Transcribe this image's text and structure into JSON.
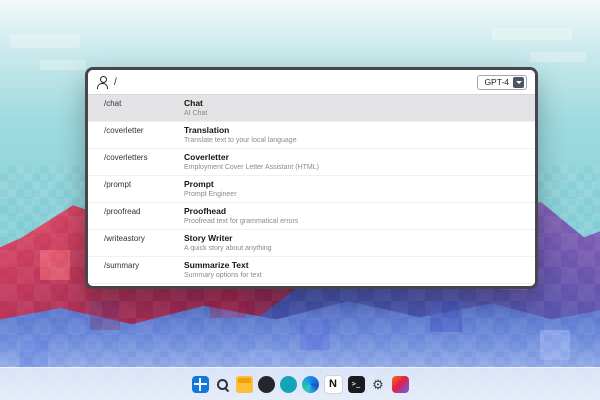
{
  "window": {
    "header": {
      "path": "/",
      "model": "GPT-4",
      "icons": {
        "left": "user-icon",
        "model_dropdown": "chevron-down-icon"
      }
    },
    "rows": [
      {
        "command": "/chat",
        "title": "Chat",
        "subtitle": "AI Chat",
        "selected": true
      },
      {
        "command": "/coverletter",
        "title": "Translation",
        "subtitle": "Translate text to your local language",
        "selected": false
      },
      {
        "command": "/coverletters",
        "title": "Coverletter",
        "subtitle": "Employment Cover Letter Assistant (HTML)",
        "selected": false
      },
      {
        "command": "/prompt",
        "title": "Prompt",
        "subtitle": "Prompt Engineer",
        "selected": false
      },
      {
        "command": "/proofread",
        "title": "Proofhead",
        "subtitle": "Proofread text for grammatical errors",
        "selected": false
      },
      {
        "command": "/writeastory",
        "title": "Story Writer",
        "subtitle": "A quick story about anything",
        "selected": false
      },
      {
        "command": "/summary",
        "title": "Summarize Text",
        "subtitle": "Summary options for text",
        "selected": false
      }
    ]
  },
  "taskbar": {
    "icons": [
      {
        "name": "start-icon",
        "glyph": ""
      },
      {
        "name": "search-icon",
        "glyph": ""
      },
      {
        "name": "file-explorer-icon",
        "glyph": ""
      },
      {
        "name": "github-icon",
        "glyph": ""
      },
      {
        "name": "chat-icon",
        "glyph": ""
      },
      {
        "name": "edge-icon",
        "glyph": ""
      },
      {
        "name": "notion-icon",
        "glyph": "N"
      },
      {
        "name": "terminal-icon",
        "glyph": ">_"
      },
      {
        "name": "settings-icon",
        "glyph": "⚙"
      },
      {
        "name": "photos-icon",
        "glyph": ""
      }
    ]
  },
  "colors": {
    "window_border": "#46464c",
    "selected_row": "#e3e3e6",
    "sky": "#8ad2d9",
    "mountain_red": "#c23b57",
    "mountain_blue": "#4e66c6",
    "taskbar_bg": "rgba(240,245,251,0.78)"
  }
}
